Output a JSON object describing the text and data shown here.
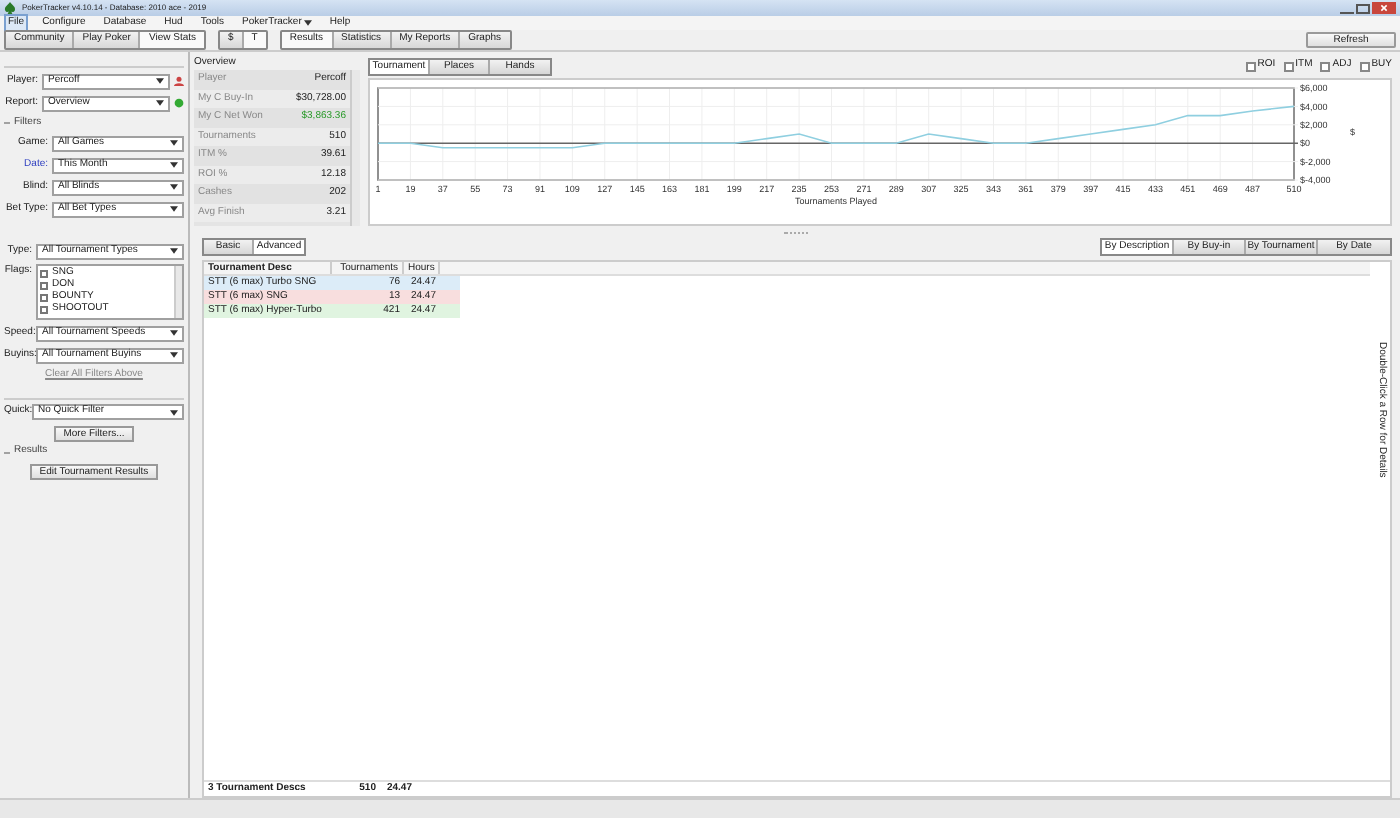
{
  "window": {
    "title": "PokerTracker v4.10.14 - Database: 2010 ace - 2019"
  },
  "menu": [
    {
      "label": "File",
      "selected": true
    },
    {
      "label": "Configure",
      "selected": false
    },
    {
      "label": "Database",
      "selected": false
    },
    {
      "label": "Hud",
      "selected": false
    },
    {
      "label": "Tools",
      "selected": false
    },
    {
      "label": "PokerTracker",
      "selected": false
    },
    {
      "label": "Help",
      "selected": false
    }
  ],
  "toolbar": {
    "groups": [
      [
        {
          "label": "Community",
          "selected": false
        },
        {
          "label": "Play Poker",
          "selected": false
        },
        {
          "label": "View Stats",
          "selected": true
        }
      ],
      [
        {
          "label": "$",
          "selected": false
        },
        {
          "label": "T",
          "selected": true
        }
      ],
      [
        {
          "label": "Results",
          "selected": true
        },
        {
          "label": "Statistics",
          "selected": false
        },
        {
          "label": "My Reports",
          "selected": false
        },
        {
          "label": "Graphs",
          "selected": false
        }
      ]
    ],
    "refresh": "Refresh"
  },
  "left": {
    "player": {
      "label": "Player:",
      "value": "Percoff"
    },
    "report": {
      "label": "Report:",
      "value": "Overview"
    },
    "filters_header": "Filters",
    "filters": [
      {
        "label": "Game:",
        "value": "All Games",
        "active": false
      },
      {
        "label": "Date:",
        "value": "This Month",
        "active": true
      },
      {
        "label": "Blind:",
        "value": "All Blinds",
        "active": false
      },
      {
        "label": "Bet Type:",
        "value": "All Bet Types",
        "active": false
      }
    ],
    "type": {
      "label": "Type:",
      "value": "All Tournament Types"
    },
    "flags_label": "Flags:",
    "flags": [
      {
        "label": "SNG",
        "checked": false
      },
      {
        "label": "DON",
        "checked": false
      },
      {
        "label": "BOUNTY",
        "checked": false
      },
      {
        "label": "SHOOTOUT",
        "checked": false
      }
    ],
    "filters2": [
      {
        "label": "Speed:",
        "value": "All Tournament Speeds"
      },
      {
        "label": "Buyins:",
        "value": "All Tournament Buyins"
      }
    ],
    "clear": "Clear All Filters Above",
    "quick": {
      "label": "Quick:",
      "value": "No Quick Filter"
    },
    "more": "More Filters...",
    "results_header": "Results",
    "edit": "Edit Tournament Results"
  },
  "overview": {
    "title": "Overview",
    "rows": [
      {
        "label": "Player",
        "value": "Percoff",
        "positive": false
      },
      {
        "label": "My C Buy-In",
        "value": "$30,728.00",
        "positive": false
      },
      {
        "label": "My C Net Won",
        "value": "$3,863.36",
        "positive": true
      },
      {
        "label": "Tournaments",
        "value": "510",
        "positive": false
      },
      {
        "label": "ITM %",
        "value": "39.61",
        "positive": false
      },
      {
        "label": "ROI %",
        "value": "12.18",
        "positive": false
      },
      {
        "label": "Cashes",
        "value": "202",
        "positive": false
      },
      {
        "label": "Avg Finish",
        "value": "3.21",
        "positive": false
      }
    ]
  },
  "chart_panel": {
    "tabs": [
      {
        "label": "Tournament",
        "selected": true
      },
      {
        "label": "Places",
        "selected": false
      },
      {
        "label": "Hands",
        "selected": false
      }
    ],
    "options": [
      {
        "label": "ROI",
        "checked": false
      },
      {
        "label": "ITM",
        "checked": false
      },
      {
        "label": "ADJ",
        "checked": false
      },
      {
        "label": "BUY",
        "checked": false
      }
    ],
    "chart_data": {
      "type": "line",
      "xlabel": "Tournaments Played",
      "ylabel": "$",
      "x": [
        1,
        19,
        37,
        55,
        73,
        91,
        109,
        127,
        145,
        163,
        181,
        199,
        217,
        235,
        253,
        271,
        289,
        307,
        325,
        343,
        361,
        379,
        397,
        415,
        433,
        451,
        469,
        487,
        510
      ],
      "grid": true,
      "series": [
        {
          "color": "#8fcfe0",
          "values": [
            0,
            0,
            -500,
            -500,
            -500,
            -500,
            -500,
            0,
            0,
            0,
            0,
            0,
            500,
            1000,
            0,
            0,
            0,
            1000,
            500,
            0,
            0,
            500,
            1000,
            1500,
            2000,
            3000,
            3000,
            3500,
            4000
          ]
        }
      ],
      "xlim": [
        1,
        510
      ],
      "ylim": [
        -4000,
        6000
      ],
      "xticks": [
        1,
        19,
        37,
        55,
        73,
        91,
        109,
        127,
        145,
        163,
        181,
        199,
        217,
        235,
        253,
        271,
        289,
        307,
        325,
        343,
        361,
        379,
        397,
        415,
        433,
        451,
        469,
        487,
        510
      ],
      "yticks": [
        {
          "value": 6000,
          "label": "$6,000"
        },
        {
          "value": 4000,
          "label": "$4,000"
        },
        {
          "value": 2000,
          "label": "$2,000"
        },
        {
          "value": 0,
          "label": "$0"
        },
        {
          "value": -2000,
          "label": "$-2,000"
        },
        {
          "value": -4000,
          "label": "$-4,000"
        }
      ]
    }
  },
  "table_panel": {
    "view_tabs": [
      {
        "label": "Basic",
        "selected": false
      },
      {
        "label": "Advanced",
        "selected": true
      }
    ],
    "group_tabs": [
      {
        "label": "By Description",
        "selected": true
      },
      {
        "label": "By Buy-in",
        "selected": false
      },
      {
        "label": "By Tournament",
        "selected": false
      },
      {
        "label": "By Date",
        "selected": false
      }
    ],
    "columns": [
      "Tournament Desc",
      "Tournaments",
      "Hours"
    ],
    "rows": [
      {
        "cells": [
          "STT (6 max) Turbo SNG",
          "76",
          "24.47"
        ],
        "color": "#dcecf8"
      },
      {
        "cells": [
          "STT (6 max) SNG",
          "13",
          "24.47"
        ],
        "color": "#f8dede"
      },
      {
        "cells": [
          "STT (6 max) Hyper-Turbo",
          "421",
          "24.47"
        ],
        "color": "#e0f4e0"
      }
    ],
    "footer": [
      "3 Tournament Descs",
      "510",
      "24.47"
    ],
    "hint": "Double-Click a Row for Details"
  }
}
